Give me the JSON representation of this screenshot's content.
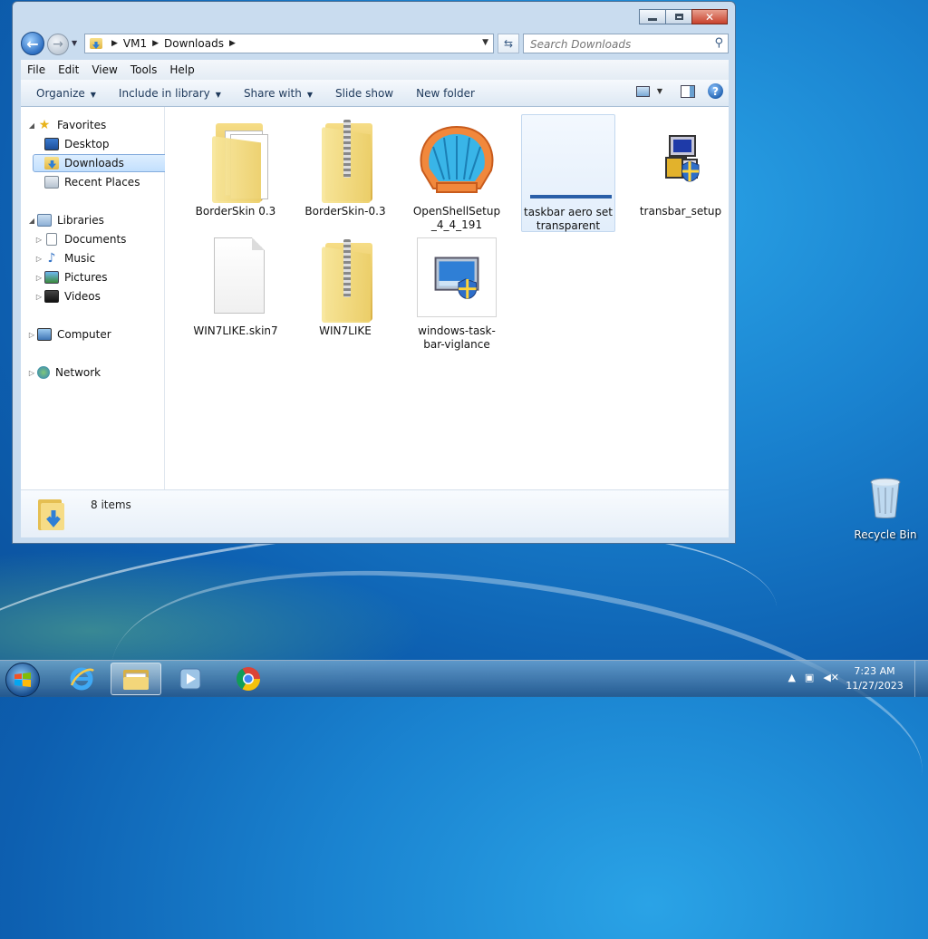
{
  "window": {
    "breadcrumb": [
      "VM1",
      "Downloads"
    ],
    "search_placeholder": "Search Downloads",
    "menu": [
      "File",
      "Edit",
      "View",
      "Tools",
      "Help"
    ],
    "commands": [
      "Organize",
      "Include in library",
      "Share with",
      "Slide show",
      "New folder"
    ]
  },
  "nav": {
    "favorites": "Favorites",
    "desktop": "Desktop",
    "downloads": "Downloads",
    "recent": "Recent Places",
    "libraries": "Libraries",
    "documents": "Documents",
    "music": "Music",
    "pictures": "Pictures",
    "videos": "Videos",
    "computer": "Computer",
    "network": "Network"
  },
  "files": [
    {
      "name": "BorderSkin 0.3",
      "type": "folder"
    },
    {
      "name": "BorderSkin-0.3",
      "type": "zip"
    },
    {
      "name": "OpenShellSetup_4_4_191",
      "type": "setup-shell"
    },
    {
      "name": "taskbar aero set transparent",
      "type": "image",
      "selected": true
    },
    {
      "name": "transbar_setup",
      "type": "setup"
    },
    {
      "name": "WIN7LIKE.skin7",
      "type": "file"
    },
    {
      "name": "WIN7LIKE",
      "type": "zip"
    },
    {
      "name": "windows-task-bar-viglance",
      "type": "image"
    }
  ],
  "details": {
    "count": "8 items"
  },
  "desktop": {
    "recycle_bin": "Recycle Bin"
  },
  "taskbar": {
    "time": "7:23 AM",
    "date": "11/27/2023"
  }
}
